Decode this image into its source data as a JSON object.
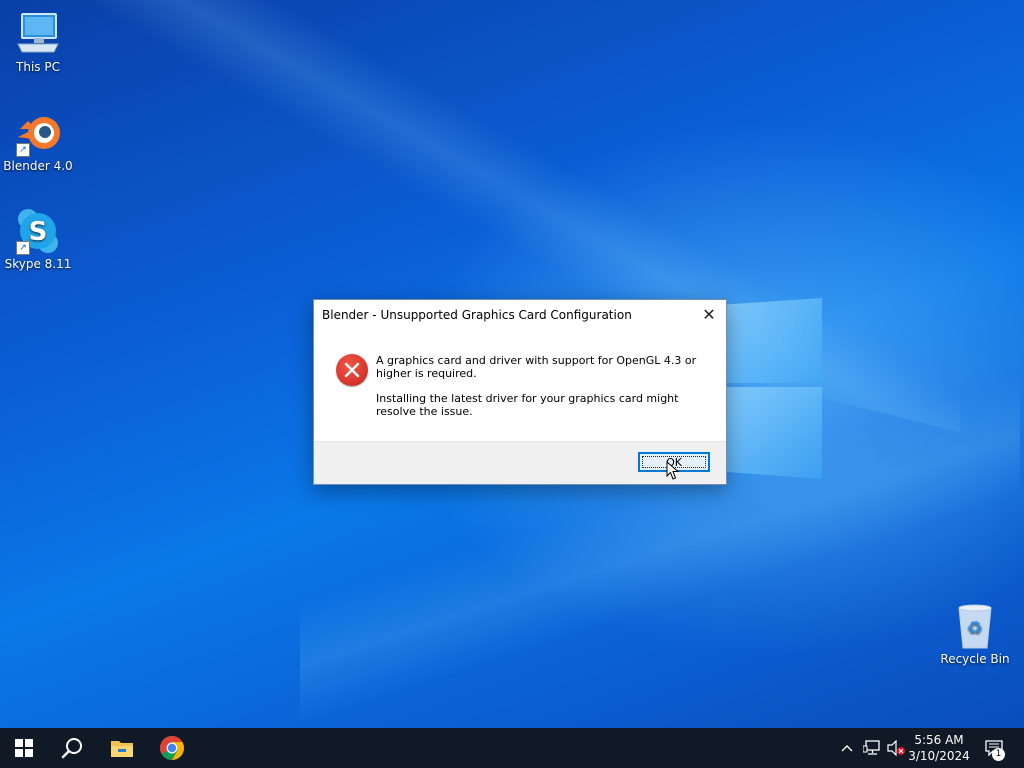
{
  "desktop": {
    "icons": [
      {
        "label": "This PC",
        "icon": "computer-icon"
      },
      {
        "label": "Blender 4.0",
        "icon": "blender-icon"
      },
      {
        "label": "Skype 8.11",
        "icon": "skype-icon"
      },
      {
        "label": "Recycle Bin",
        "icon": "recycle-bin-icon"
      }
    ]
  },
  "dialog": {
    "title": "Blender - Unsupported Graphics Card Configuration",
    "close_glyph": "✕",
    "message_1": "A graphics card and driver with support for OpenGL 4.3 or higher is required.",
    "message_2": "Installing the latest driver for your graphics card might resolve the issue.",
    "ok_label": "OK",
    "icon": "error-icon"
  },
  "taskbar": {
    "apps": [
      "start-icon",
      "search-icon",
      "file-explorer-icon",
      "chrome-icon"
    ],
    "tray": {
      "time": "5:56 AM",
      "date": "3/10/2024",
      "notification_count": "1"
    }
  },
  "colors": {
    "accent": "#0078d7",
    "error": "#e0352b",
    "taskbar": "#0f1a26"
  }
}
